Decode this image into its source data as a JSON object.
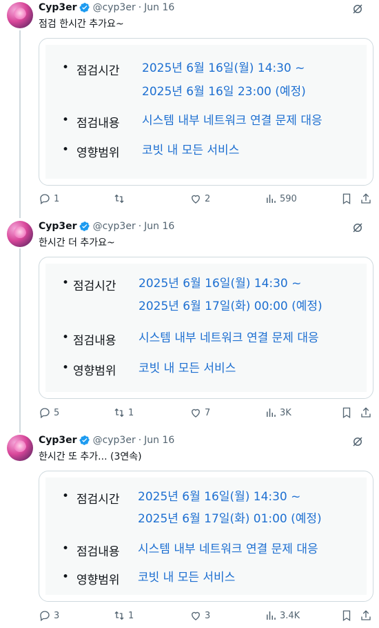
{
  "tweets": [
    {
      "name": "Cyp3er",
      "handle": "@cyp3er",
      "date": "Jun 16",
      "text": "점검 한시간 추가요~",
      "card": {
        "rows": [
          {
            "label": "점검시간",
            "lines": [
              "2025년 6월 16일(월) 14:30 ~",
              "2025년 6월 16일 23:00 (예정)"
            ]
          },
          {
            "label": "점검내용",
            "lines": [
              "시스템 내부 네트워크 연결 문제 대응"
            ]
          },
          {
            "label": "영향범위",
            "lines": [
              "코빗 내 모든 서비스"
            ]
          }
        ]
      },
      "stats": {
        "replies": "1",
        "reposts": "",
        "likes": "2",
        "views": "590"
      }
    },
    {
      "name": "Cyp3er",
      "handle": "@cyp3er",
      "date": "Jun 16",
      "text": "한시간 더 추가요~",
      "card": {
        "rows": [
          {
            "label": "점검시간",
            "lines": [
              "2025년 6월 16일(월) 14:30 ~",
              "2025년 6월 17일(화) 00:00 (예정)"
            ]
          },
          {
            "label": "점검내용",
            "lines": [
              "시스템 내부 네트워크 연결 문제 대응"
            ]
          },
          {
            "label": "영향범위",
            "lines": [
              "코빗 내 모든 서비스"
            ]
          }
        ]
      },
      "stats": {
        "replies": "5",
        "reposts": "1",
        "likes": "7",
        "views": "3K"
      }
    },
    {
      "name": "Cyp3er",
      "handle": "@cyp3er",
      "date": "Jun 16",
      "text": "한시간 또 추가... (3연속)",
      "card": {
        "rows": [
          {
            "label": "점검시간",
            "lines": [
              "2025년 6월 16일(월) 14:30 ~",
              "2025년 6월 17일(화) 01:00 (예정)"
            ]
          },
          {
            "label": "점검내용",
            "lines": [
              "시스템 내부 네트워크 연결 문제 대응"
            ]
          },
          {
            "label": "영향범위",
            "lines": [
              "코빗 내 모든 서비스"
            ]
          }
        ]
      },
      "stats": {
        "replies": "3",
        "reposts": "1",
        "likes": "3",
        "views": "3.4K"
      }
    }
  ],
  "ui": {
    "separator": "·",
    "bullet": "•"
  },
  "colors": {
    "link_blue": "#1d6fd1",
    "verified_blue": "#1d9bf0",
    "muted": "#536471",
    "card_bg": "#f7f9f9"
  }
}
